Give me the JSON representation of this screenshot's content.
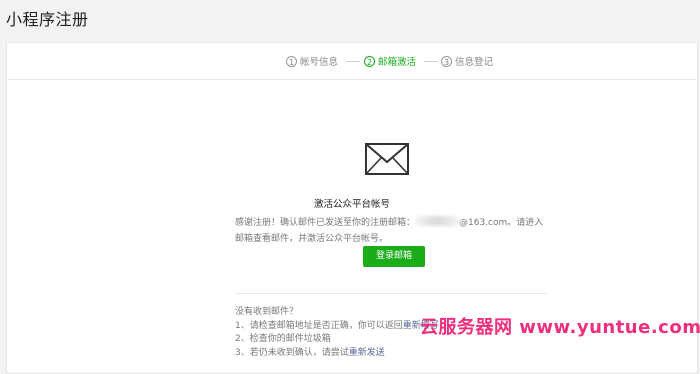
{
  "page": {
    "title": "小程序注册"
  },
  "steps": [
    {
      "num": "1",
      "label": "帐号信息",
      "active": false
    },
    {
      "num": "2",
      "label": "邮箱激活",
      "active": true
    },
    {
      "num": "3",
      "label": "信息登记",
      "active": false
    }
  ],
  "main": {
    "heading": "激活公众平台帐号",
    "desc_part1": "感谢注册！确认邮件已发送至你的注册邮箱：",
    "desc_email_suffix": "@163.com",
    "desc_part2": "。请进入邮箱查看邮件，并激活公众平台帐号。",
    "login_button": "登录邮箱"
  },
  "help": {
    "title": "没有收到邮件？",
    "item1_text": "1、请检查邮箱地址是否正确，你可以返回",
    "item1_link": "重新填写",
    "item2_text": "2、检查你的邮件垃圾箱",
    "item3_text": "3、若仍未收到确认，请尝试",
    "item3_link": "重新发送"
  },
  "watermark": {
    "text": "云服务器网 www.yuntue.com"
  },
  "colors": {
    "accent": "#1aad19",
    "link": "#576b95",
    "watermark": "#ee2f7d"
  },
  "icons": {
    "envelope": "envelope-icon"
  }
}
